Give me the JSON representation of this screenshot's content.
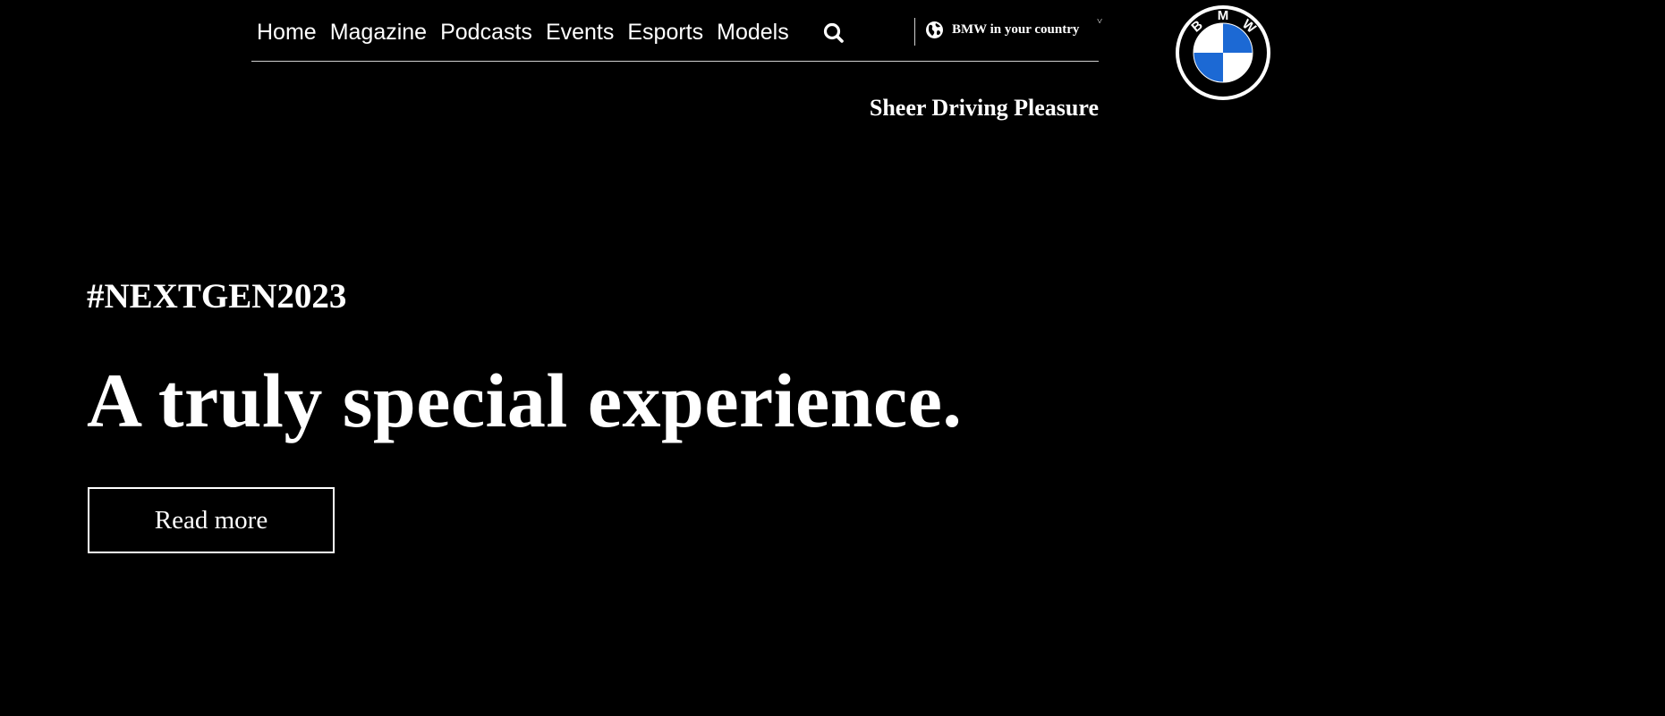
{
  "colors": {
    "background": "#000000",
    "text": "#ffffff",
    "divider": "#cfcfcf",
    "logo_blue": "#1c69d4"
  },
  "nav": {
    "items": [
      {
        "label": "Home"
      },
      {
        "label": "Magazine"
      },
      {
        "label": "Podcasts"
      },
      {
        "label": "Events"
      },
      {
        "label": "Esports"
      },
      {
        "label": "Models"
      }
    ],
    "search_icon": "search-icon",
    "country_icon": "globe-icon",
    "country_label": "BMW in your country",
    "country_caret": "˅"
  },
  "header": {
    "slogan": "Sheer Driving Pleasure"
  },
  "logo": {
    "letters": [
      "B",
      "M",
      "W"
    ]
  },
  "hero": {
    "tag": "#NEXTGEN2023",
    "title": "A truly special experience.",
    "cta_label": "Read more"
  }
}
